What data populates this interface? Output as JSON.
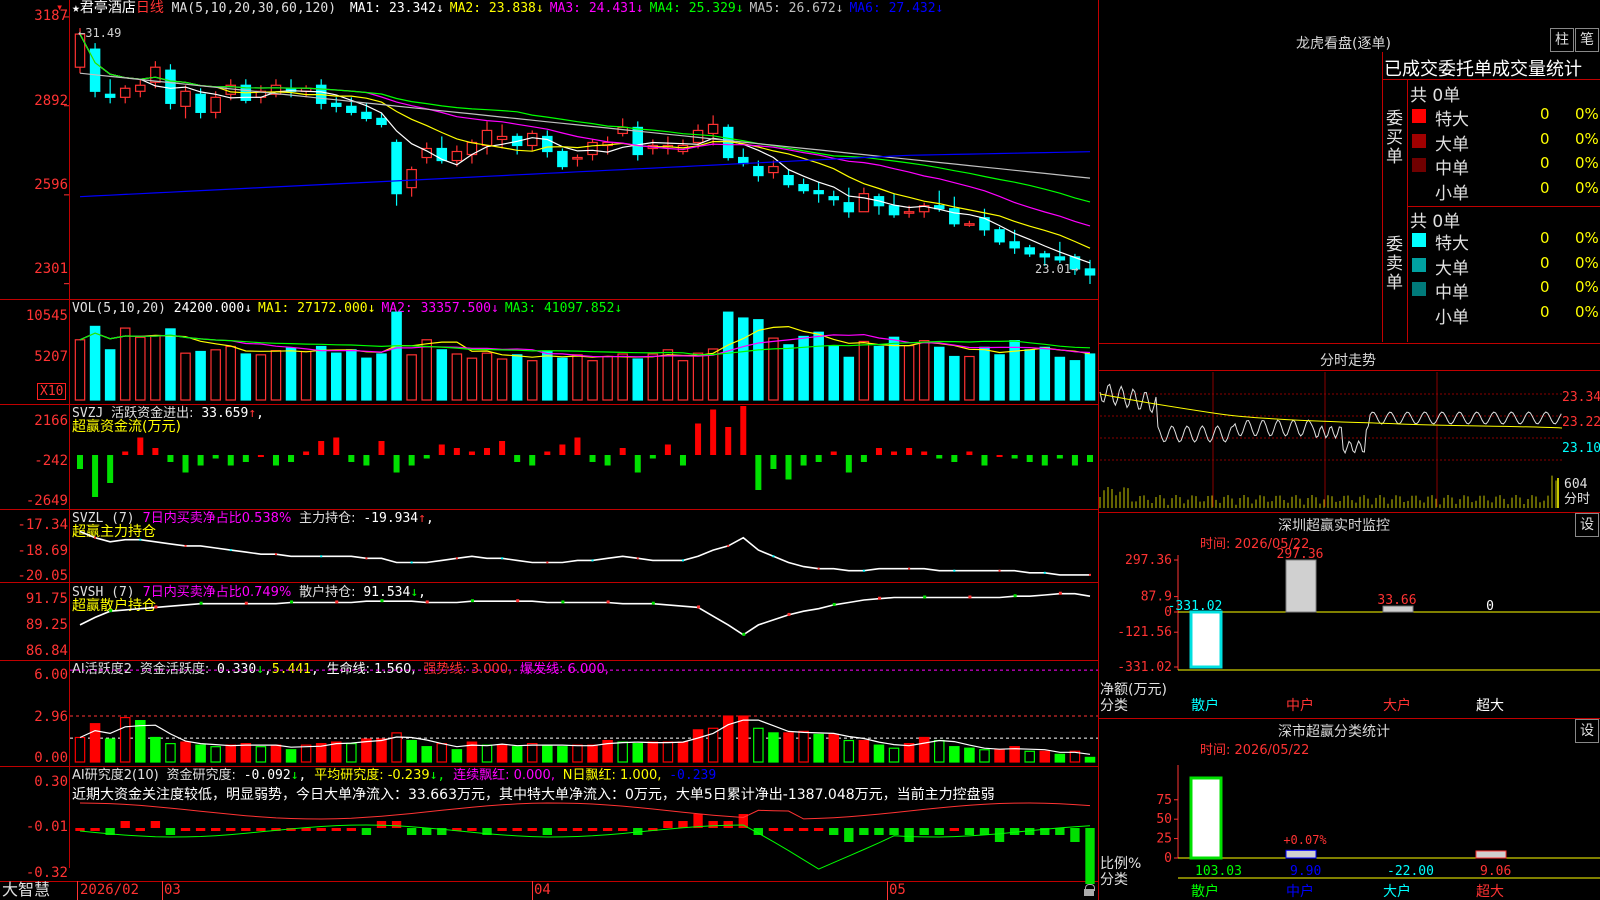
{
  "header": {
    "star_label": "★",
    "stock_name": "君亭酒店",
    "period": "日线",
    "ma_spec": "MA(5,10,20,30,60,120)",
    "ma": [
      {
        "label": "MA1:",
        "value": "23.342↓",
        "color": "#ffffff"
      },
      {
        "label": "MA2:",
        "value": "23.838↓",
        "color": "#ffff00"
      },
      {
        "label": "MA3:",
        "value": "24.431↓",
        "color": "#ff00ff"
      },
      {
        "label": "MA4:",
        "value": "25.329↓",
        "color": "#00ff00"
      },
      {
        "label": "MA5:",
        "value": "26.672↓",
        "color": "#c0c0c0"
      },
      {
        "label": "MA6:",
        "value": "27.432↓",
        "color": "#0000ff"
      }
    ],
    "high_marker": "31.49",
    "low_marker": "23.01"
  },
  "y_ticks": {
    "price": [
      "3187",
      "2892",
      "2596",
      "2301"
    ],
    "vol": [
      "10545",
      "5207"
    ],
    "vol_unit": "X10",
    "svzj": [
      "2166",
      "-242",
      "-2649"
    ],
    "svzl": [
      "-17.34",
      "-18.69",
      "-20.05"
    ],
    "svsh": [
      "91.75",
      "89.25",
      "86.84"
    ],
    "ai1": [
      "6.00",
      "2.96",
      "0.00"
    ],
    "ai2": [
      "0.30",
      "-0.01",
      "-0.32"
    ]
  },
  "panels": {
    "vol": {
      "spec": "VOL(5,10,20)",
      "value": "24200.000↓",
      "items": [
        {
          "label": "MA1:",
          "value": "27172.000↓",
          "color": "#ffff00"
        },
        {
          "label": "MA2:",
          "value": "33357.500↓",
          "color": "#ff00ff"
        },
        {
          "label": "MA3:",
          "value": "41097.852↓",
          "color": "#00ff00"
        }
      ]
    },
    "svzj": {
      "name": "SVZJ",
      "label": "活跃资金进出:",
      "value": "33.659",
      "arrow": "↑",
      "sub": "超赢资金流(万元)"
    },
    "svzl": {
      "name": "SVZL (7)",
      "label7": "7日内买卖净占比0.538%",
      "label": "主力持仓:",
      "value": "-19.934",
      "arrow": "↑",
      "sub": "超赢主力持仓"
    },
    "svsh": {
      "name": "SVSH (7)",
      "label7": "7日内买卖净占比0.749%",
      "label": "散户持仓:",
      "value": "91.534",
      "arrow": "↓",
      "sub": "超赢散户持仓"
    },
    "ai1": {
      "name": "AI活跃度2",
      "label": "资金活跃度:",
      "value": "0.330",
      "arrow": "↓",
      "v2": "5.441",
      "life": "生命线: 1.560,",
      "strong": "强势线: 3.000,",
      "burst": "爆发线: 6.000,"
    },
    "ai2": {
      "name": "AI研究度2(10)",
      "label": "资金研究度:",
      "value": "-0.092",
      "arrow": "↓",
      "avg": "平均研究度: -0.239",
      "cont": "连续飘红: 0.000,",
      "nday": "N日飘红: 1.000,",
      "last": "-0.239",
      "comment": "近期大资金关注度较低，明显弱势，今日大单净流入：33.663万元，其中特大单净流入：0万元，大单5日累计净出-1387.048万元，当前主力控盘弱"
    }
  },
  "x_axis": {
    "brand": "大智慧",
    "labels": [
      "2026/02",
      "03",
      "04",
      "05"
    ]
  },
  "right": {
    "dragon_title": "龙虎看盘(逐单)",
    "btn_zhu": "柱",
    "btn_bi": "笔",
    "stats_title": "已成交委托单成交量统计",
    "buy_group": {
      "side": "委买单",
      "total": "共 0单",
      "rows": [
        {
          "name": "特大",
          "n": "0",
          "p": "0%",
          "color": "#ff0000"
        },
        {
          "name": "大单",
          "n": "0",
          "p": "0%",
          "color": "#a00000"
        },
        {
          "name": "中单",
          "n": "0",
          "p": "0%",
          "color": "#700000"
        },
        {
          "name": "小单",
          "n": "0",
          "p": "0%",
          "color": ""
        }
      ]
    },
    "sell_group": {
      "side": "委卖单",
      "total": "共 0单",
      "rows": [
        {
          "name": "特大",
          "n": "0",
          "p": "0%",
          "color": "#00ffff"
        },
        {
          "name": "大单",
          "n": "0",
          "p": "0%",
          "color": "#00a0a0"
        },
        {
          "name": "中单",
          "n": "0",
          "p": "0%",
          "color": "#007a7a"
        },
        {
          "name": "小单",
          "n": "0",
          "p": "0%",
          "color": ""
        }
      ]
    },
    "intraday_title": "分时走势",
    "intraday_ticks": [
      "23.34",
      "23.22",
      "23.10"
    ],
    "intraday_vol": "604",
    "intraday_vol_label": "分时",
    "monitor": {
      "title": "深圳超赢实时监控",
      "btn": "设",
      "time": "时间: 2026/05/22",
      "y_ticks": [
        "297.36",
        "87.9",
        "0",
        "-121.56",
        "-331.02"
      ],
      "y_label": "净额(万元)",
      "x_label": "分类",
      "values": [
        "-331.02",
        "297.36",
        "33.66",
        "0"
      ],
      "categories": [
        "散户",
        "中户",
        "大户",
        "超大"
      ]
    },
    "classify": {
      "title": "深市超赢分类统计",
      "btn": "设",
      "time": "时间: 2026/05/22",
      "y_ticks": [
        "75",
        "50",
        "25",
        "0"
      ],
      "y_label": "比例%",
      "x_label": "分类",
      "values": [
        "103.03",
        "9.90",
        "-22.00",
        "9.06"
      ],
      "extra": "+0.07%",
      "categories": [
        "散户",
        "中户",
        "大户",
        "超大"
      ]
    }
  },
  "chart_data": {
    "type": "candlestick",
    "title": "君亭酒店 日线",
    "ylim": [
      23.01,
      31.87
    ],
    "candles": [
      [
        30.2,
        31.5,
        30.0,
        31.3
      ],
      [
        30.8,
        31.0,
        29.2,
        29.4
      ],
      [
        29.3,
        29.8,
        29.0,
        29.2
      ],
      [
        29.2,
        29.6,
        29.0,
        29.5
      ],
      [
        29.4,
        29.8,
        29.2,
        29.6
      ],
      [
        29.7,
        30.4,
        29.5,
        30.2
      ],
      [
        30.1,
        30.3,
        28.8,
        29.0
      ],
      [
        28.9,
        29.6,
        28.5,
        29.4
      ],
      [
        29.3,
        29.5,
        28.5,
        28.7
      ],
      [
        28.7,
        29.4,
        28.5,
        29.2
      ],
      [
        29.3,
        29.8,
        29.1,
        29.6
      ],
      [
        29.6,
        29.8,
        29.0,
        29.1
      ],
      [
        29.2,
        29.6,
        29.0,
        29.4
      ],
      [
        29.3,
        29.8,
        29.2,
        29.6
      ],
      [
        29.5,
        29.8,
        29.2,
        29.4
      ],
      [
        29.4,
        29.6,
        29.2,
        29.5
      ],
      [
        29.6,
        29.8,
        28.8,
        29.0
      ],
      [
        29.0,
        29.2,
        28.7,
        28.9
      ],
      [
        28.9,
        29.2,
        28.6,
        28.7
      ],
      [
        28.7,
        29.0,
        28.4,
        28.5
      ],
      [
        28.5,
        28.7,
        28.2,
        28.3
      ],
      [
        27.7,
        27.8,
        25.6,
        26.0
      ],
      [
        26.2,
        26.9,
        25.9,
        26.8
      ],
      [
        27.2,
        27.7,
        27.0,
        27.5
      ],
      [
        27.5,
        27.9,
        27.0,
        27.1
      ],
      [
        27.1,
        27.6,
        26.9,
        27.4
      ],
      [
        27.3,
        27.8,
        27.0,
        27.7
      ],
      [
        27.6,
        28.4,
        27.3,
        28.1
      ],
      [
        27.8,
        28.3,
        27.5,
        27.9
      ],
      [
        27.9,
        28.0,
        27.3,
        27.6
      ],
      [
        27.6,
        28.1,
        27.4,
        28.0
      ],
      [
        27.9,
        28.1,
        27.2,
        27.4
      ],
      [
        27.4,
        27.5,
        26.8,
        26.9
      ],
      [
        27.2,
        27.3,
        26.9,
        27.2
      ],
      [
        27.3,
        27.8,
        27.1,
        27.7
      ],
      [
        27.6,
        27.9,
        27.3,
        27.7
      ],
      [
        28.0,
        28.5,
        27.9,
        28.2
      ],
      [
        28.2,
        28.4,
        27.1,
        27.3
      ],
      [
        27.5,
        27.8,
        27.3,
        27.6
      ],
      [
        27.6,
        27.9,
        27.3,
        27.6
      ],
      [
        27.4,
        27.8,
        27.3,
        27.6
      ],
      [
        27.7,
        28.3,
        27.5,
        28.1
      ],
      [
        28.0,
        28.6,
        27.6,
        28.3
      ],
      [
        28.2,
        28.3,
        27.1,
        27.2
      ],
      [
        27.2,
        27.5,
        26.9,
        27.0
      ],
      [
        26.9,
        27.1,
        26.4,
        26.6
      ],
      [
        26.7,
        27.1,
        26.5,
        26.9
      ],
      [
        26.6,
        26.8,
        26.2,
        26.3
      ],
      [
        26.3,
        26.5,
        26.0,
        26.1
      ],
      [
        26.1,
        26.4,
        25.7,
        26.0
      ],
      [
        25.9,
        26.1,
        25.6,
        25.8
      ],
      [
        25.7,
        26.2,
        25.2,
        25.4
      ],
      [
        25.4,
        26.2,
        25.4,
        26.0
      ],
      [
        25.9,
        26.0,
        25.3,
        25.6
      ],
      [
        25.6,
        26.0,
        25.2,
        25.3
      ],
      [
        25.4,
        25.6,
        25.2,
        25.4
      ],
      [
        25.4,
        25.7,
        25.2,
        25.6
      ],
      [
        25.6,
        26.1,
        25.4,
        25.5
      ],
      [
        25.5,
        25.9,
        24.9,
        25.0
      ],
      [
        25.0,
        25.1,
        24.9,
        25.0
      ],
      [
        25.2,
        25.5,
        24.6,
        24.8
      ],
      [
        24.8,
        24.9,
        24.3,
        24.4
      ],
      [
        24.4,
        24.8,
        24.0,
        24.2
      ],
      [
        24.2,
        24.3,
        23.9,
        24.0
      ],
      [
        24.0,
        24.1,
        23.6,
        23.9
      ],
      [
        23.9,
        24.4,
        23.7,
        23.8
      ],
      [
        23.9,
        24.0,
        23.3,
        23.5
      ],
      [
        23.5,
        23.8,
        23.0,
        23.3
      ]
    ],
    "volume": [
      7.2,
      8.8,
      6.0,
      8.6,
      7.5,
      7.7,
      8.5,
      5.6,
      5.8,
      6.0,
      6.4,
      5.5,
      5.4,
      5.9,
      6.2,
      5.8,
      6.4,
      5.6,
      6.0,
      5.0,
      5.5,
      10.5,
      5.4,
      7.2,
      6.0,
      5.5,
      5.0,
      5.6,
      4.9,
      5.4,
      4.7,
      5.8,
      5.0,
      5.4,
      4.7,
      5.2,
      5.5,
      4.9,
      5.5,
      6.0,
      4.7,
      5.6,
      6.1,
      10.5,
      9.8,
      9.6,
      7.4,
      6.6,
      7.6,
      8.1,
      6.5,
      5.1,
      7.0,
      6.4,
      7.5,
      6.5,
      7.1,
      6.3,
      5.2,
      5.2,
      6.3,
      5.4,
      7.1,
      6.0,
      6.3,
      5.1,
      4.7,
      5.5
    ],
    "svzj": [
      -0.4,
      -1.2,
      -0.8,
      0.1,
      0.5,
      0.2,
      -0.2,
      -0.5,
      -0.3,
      -0.1,
      -0.3,
      -0.2,
      0.0,
      -0.3,
      -0.2,
      0.1,
      0.4,
      0.5,
      -0.2,
      -0.3,
      0.4,
      -0.5,
      -0.3,
      -0.1,
      0.3,
      0.2,
      0.1,
      0.2,
      0.4,
      -0.2,
      -0.3,
      0.1,
      0.3,
      0.5,
      -0.2,
      -0.3,
      0.2,
      -0.5,
      -0.1,
      0.3,
      -0.3,
      0.9,
      1.3,
      0.8,
      1.4,
      -1.0,
      -0.4,
      -0.7,
      -0.3,
      -0.2,
      0.1,
      -0.5,
      -0.2,
      0.2,
      0.1,
      0.2,
      0.1,
      -0.1,
      -0.2,
      0.1,
      -0.3,
      0.0,
      -0.1,
      -0.2,
      -0.3,
      -0.1,
      -0.3,
      -0.2
    ],
    "svzl": [
      -17.9,
      -18.2,
      -18.4,
      -18.3,
      -18.3,
      -18.4,
      -18.5,
      -18.6,
      -18.6,
      -18.7,
      -18.8,
      -18.9,
      -19.0,
      -19.0,
      -19.1,
      -19.1,
      -19.1,
      -19.1,
      -19.1,
      -19.2,
      -19.2,
      -19.4,
      -19.4,
      -19.4,
      -19.3,
      -19.2,
      -19.1,
      -19.2,
      -19.2,
      -19.3,
      -19.4,
      -19.4,
      -19.4,
      -19.3,
      -19.3,
      -19.2,
      -19.1,
      -19.2,
      -19.3,
      -19.3,
      -19.3,
      -19.1,
      -18.8,
      -18.6,
      -18.2,
      -18.8,
      -19.1,
      -19.4,
      -19.6,
      -19.7,
      -19.7,
      -19.8,
      -19.8,
      -19.7,
      -19.7,
      -19.7,
      -19.7,
      -19.8,
      -19.8,
      -19.8,
      -19.8,
      -19.8,
      -19.8,
      -19.9,
      -19.9,
      -20.0,
      -20.0,
      -20.0
    ],
    "svsh": [
      89.2,
      89.8,
      90.3,
      90.4,
      90.5,
      90.6,
      90.7,
      90.8,
      90.9,
      90.9,
      90.9,
      90.9,
      90.9,
      90.9,
      91.0,
      91.0,
      91.0,
      91.0,
      91.0,
      91.1,
      91.1,
      91.1,
      91.1,
      91.0,
      91.0,
      91.0,
      91.1,
      91.1,
      91.1,
      91.1,
      91.1,
      91.0,
      91.0,
      91.0,
      91.0,
      91.0,
      90.9,
      90.9,
      90.9,
      90.8,
      90.7,
      90.6,
      89.9,
      89.2,
      88.4,
      89.2,
      89.6,
      90.0,
      90.3,
      90.5,
      90.8,
      91.0,
      91.2,
      91.3,
      91.4,
      91.4,
      91.4,
      91.4,
      91.4,
      91.4,
      91.4,
      91.4,
      91.5,
      91.5,
      91.6,
      91.7,
      91.7,
      91.5
    ],
    "ai1": [
      1.6,
      2.5,
      1.5,
      2.9,
      2.7,
      1.6,
      1.2,
      1.3,
      1.1,
      1.0,
      1.1,
      1.2,
      1.0,
      1.1,
      0.8,
      1.1,
      1.2,
      1.3,
      1.2,
      1.5,
      1.5,
      1.9,
      1.4,
      1.0,
      1.2,
      0.8,
      1.3,
      1.1,
      1.1,
      1.0,
      1.2,
      1.1,
      1.0,
      1.1,
      1.1,
      1.4,
      1.3,
      1.2,
      1.3,
      1.3,
      1.3,
      2.1,
      2.2,
      3.0,
      3.0,
      2.2,
      1.9,
      1.9,
      2.0,
      1.8,
      1.8,
      1.4,
      1.4,
      1.1,
      0.9,
      1.2,
      1.6,
      1.4,
      1.0,
      0.9,
      0.8,
      0.8,
      1.0,
      0.7,
      0.7,
      0.5,
      0.7,
      0.3
    ],
    "ai2": [
      -0.01,
      -0.01,
      -0.02,
      0.0,
      -0.01,
      0.0,
      -0.02,
      -0.01,
      -0.01,
      -0.01,
      -0.01,
      -0.01,
      -0.01,
      -0.01,
      -0.01,
      -0.01,
      -0.01,
      -0.01,
      -0.01,
      -0.02,
      0.0,
      0.0,
      -0.02,
      -0.02,
      -0.02,
      -0.01,
      -0.01,
      -0.02,
      -0.01,
      -0.01,
      -0.01,
      -0.02,
      -0.01,
      -0.01,
      -0.01,
      -0.01,
      -0.01,
      -0.02,
      -0.01,
      0.0,
      0.0,
      0.01,
      0.0,
      0.0,
      0.01,
      -0.02,
      -0.01,
      -0.01,
      -0.01,
      -0.01,
      -0.02,
      -0.03,
      -0.02,
      -0.02,
      -0.02,
      -0.03,
      -0.02,
      -0.02,
      -0.01,
      -0.02,
      -0.02,
      -0.03,
      -0.02,
      -0.02,
      -0.02,
      -0.02,
      -0.03,
      -0.09
    ]
  }
}
